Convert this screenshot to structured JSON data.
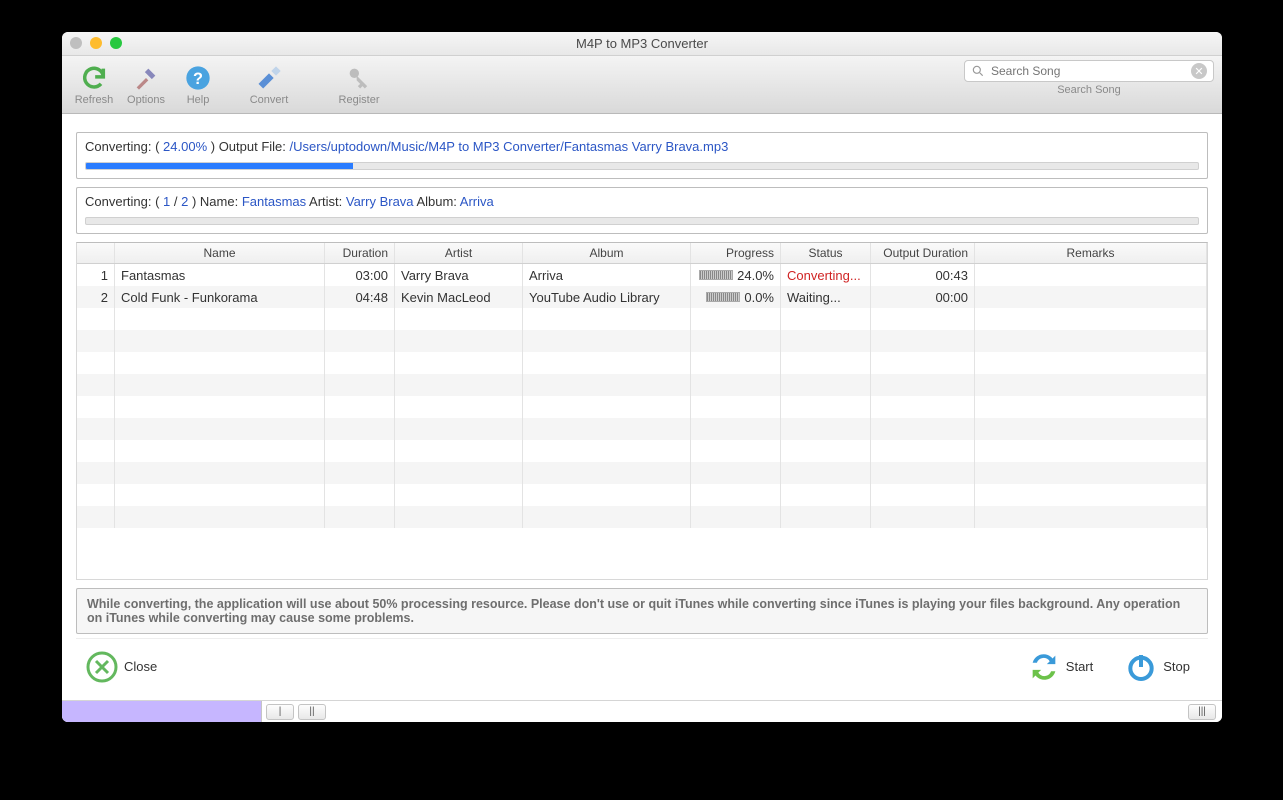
{
  "window": {
    "title": "M4P to MP3 Converter"
  },
  "toolbar": {
    "refresh": "Refresh",
    "options": "Options",
    "help": "Help",
    "convert": "Convert",
    "register": "Register"
  },
  "search": {
    "placeholder": "Search Song",
    "label": "Search Song"
  },
  "panel1": {
    "prefix": "Converting: ( ",
    "percent": "24.00%",
    "mid": " ) Output File: ",
    "path": "/Users/uptodown/Music/M4P to MP3 Converter/Fantasmas Varry Brava.mp3",
    "progress_pct": 24
  },
  "panel2": {
    "prefix": "Converting: ( ",
    "cur": "1",
    "sep": " / ",
    "total": "2",
    "suffix": " )  Name: ",
    "name": "Fantasmas",
    "artist_l": "  Artist: ",
    "artist": "Varry Brava",
    "album_l": "  Album: ",
    "album": "Arriva",
    "progress_pct": 0
  },
  "columns": [
    "",
    "Name",
    "Duration",
    "Artist",
    "Album",
    "Progress",
    "Status",
    "Output Duration",
    "Remarks"
  ],
  "rows": [
    {
      "idx": "1",
      "name": "Fantasmas",
      "dur": "03:00",
      "artist": "Varry Brava",
      "album": "Arriva",
      "prog": "24.0%",
      "status": "Converting...",
      "status_cls": "status-converting",
      "odur": "00:43",
      "rem": ""
    },
    {
      "idx": "2",
      "name": "Cold Funk - Funkorama",
      "dur": "04:48",
      "artist": "Kevin MacLeod",
      "album": "YouTube Audio Library",
      "prog": "0.0%",
      "status": "Waiting...",
      "status_cls": "",
      "odur": "00:00",
      "rem": ""
    }
  ],
  "notice": "While converting, the application will use about 50% processing resource. Please don't use or quit iTunes while converting since iTunes is playing your files background. Any operation on iTunes while converting may cause some problems.",
  "footer": {
    "close": "Close",
    "start": "Start",
    "stop": "Stop"
  }
}
